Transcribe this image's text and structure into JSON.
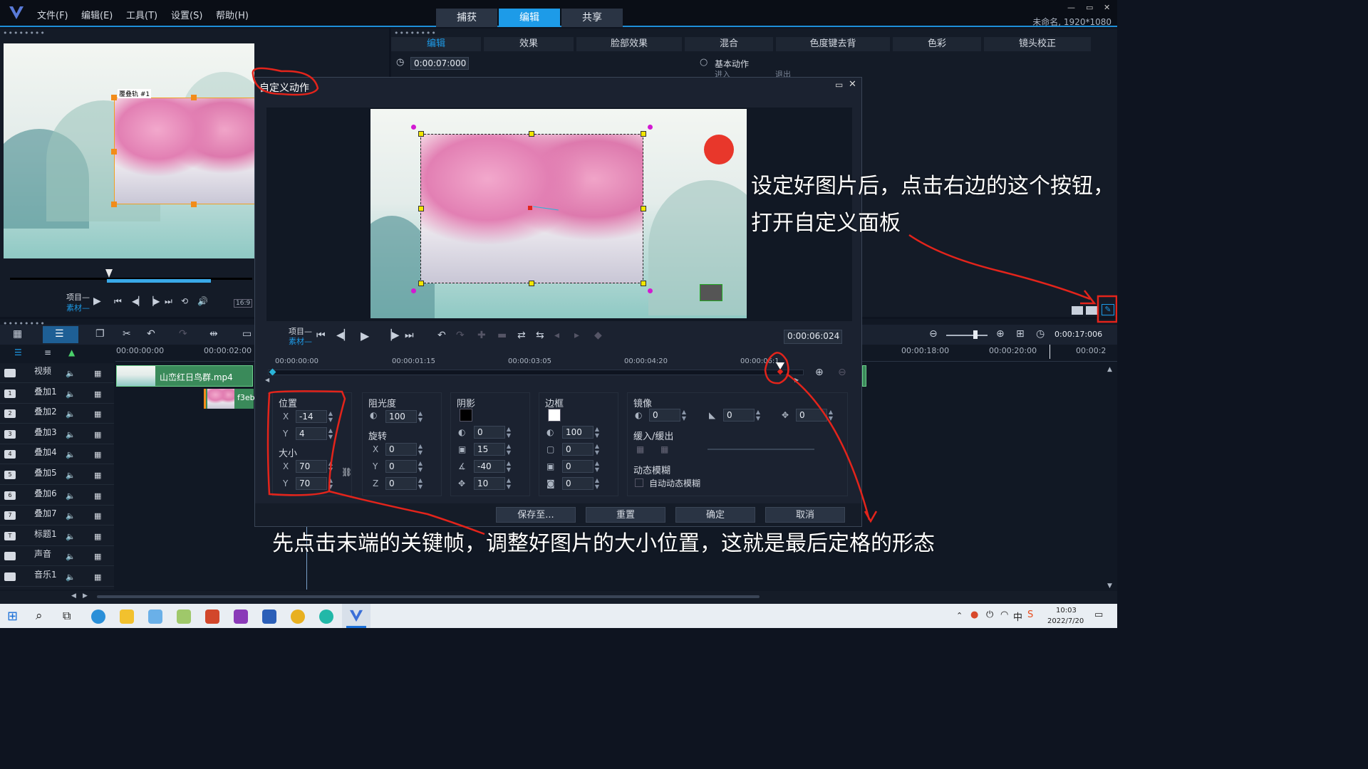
{
  "app": {
    "menu": [
      "文件(F)",
      "编辑(E)",
      "工具(T)",
      "设置(S)",
      "帮助(H)"
    ],
    "modes": [
      "捕获",
      "编辑",
      "共享"
    ],
    "active_mode": "编辑",
    "project_name": "未命名, 1920*1080",
    "window_controls": [
      "—",
      "▭",
      "✕"
    ]
  },
  "preview": {
    "overlay_label": "覆叠轨 #1",
    "project_label": "项目—",
    "clip_label": "素材—",
    "ratio": "16:9"
  },
  "editor": {
    "tabs": [
      "编辑",
      "效果",
      "脸部效果",
      "混合",
      "色度键去背",
      "色彩",
      "镜头校正"
    ],
    "active_tab": "编辑",
    "duration": "0:00:07:000",
    "basic_motion": "基本动作",
    "enter": "进入",
    "exit": "退出"
  },
  "dialog": {
    "title": "自定义动作",
    "project_label": "项目—",
    "clip_label": "素材—",
    "timecode": "0:00:06:024",
    "ruler": [
      "00:00:00:00",
      "00:00:01:15",
      "00:00:03:05",
      "00:00:04:20",
      "00:00:06:1"
    ],
    "position": {
      "label": "位置",
      "x_label": "X",
      "x": "-14",
      "y_label": "Y",
      "y": "4"
    },
    "size": {
      "label": "大小",
      "x_label": "X",
      "x": "70",
      "y_label": "Y",
      "y": "70"
    },
    "opacity": {
      "label": "阻光度",
      "value": "100"
    },
    "rotation": {
      "label": "旋转",
      "x_label": "X",
      "x": "0",
      "y_label": "Y",
      "y": "0",
      "z_label": "Z",
      "z": "0"
    },
    "shadow": {
      "label": "阴影",
      "v1": "0",
      "v2": "15",
      "v3": "-40",
      "v4": "10"
    },
    "border": {
      "label": "边框",
      "v1": "100",
      "v2": "0",
      "v3": "0",
      "v4": "0"
    },
    "mirror": {
      "label": "镜像",
      "v1": "0",
      "v2": "0",
      "v3": "0"
    },
    "ease": {
      "label": "缓入/缓出"
    },
    "motion_blur": {
      "label": "动态模糊",
      "auto": "自动动态模糊"
    },
    "buttons": {
      "save": "保存至...",
      "reset": "重置",
      "ok": "确定",
      "cancel": "取消"
    }
  },
  "timeline": {
    "zoom_time": "0:00:17:006",
    "ruler_left": [
      "00:00:00:00",
      "00:00:02:00"
    ],
    "ruler_right": [
      "00:00:18:00",
      "00:00:20:00",
      "00:00:2"
    ],
    "tracks": [
      "视频",
      "叠加1",
      "叠加2",
      "叠加3",
      "叠加4",
      "叠加5",
      "叠加6",
      "叠加7",
      "标题1",
      "声音",
      "音乐1"
    ],
    "track_nums": [
      "",
      "1",
      "2",
      "3",
      "4",
      "5",
      "6",
      "7",
      "T",
      "",
      ""
    ],
    "clip_video": "山峦红日鸟群.mp4",
    "clip_overlay": "f3eba"
  },
  "annotations": {
    "right": [
      "设定好图片后，点击右边的这个按钮，",
      "打开自定义面板"
    ],
    "bottom": "先点击末端的关键帧，调整好图片的大小位置，这就是最后定格的形态"
  },
  "taskbar": {
    "time": "10:03",
    "date": "2022/7/20"
  },
  "colors": {
    "accent": "#1d9be8",
    "annotation_red": "#e3241b",
    "handle_yellow": "#f2e600",
    "handle_magenta": "#d21ad2"
  }
}
